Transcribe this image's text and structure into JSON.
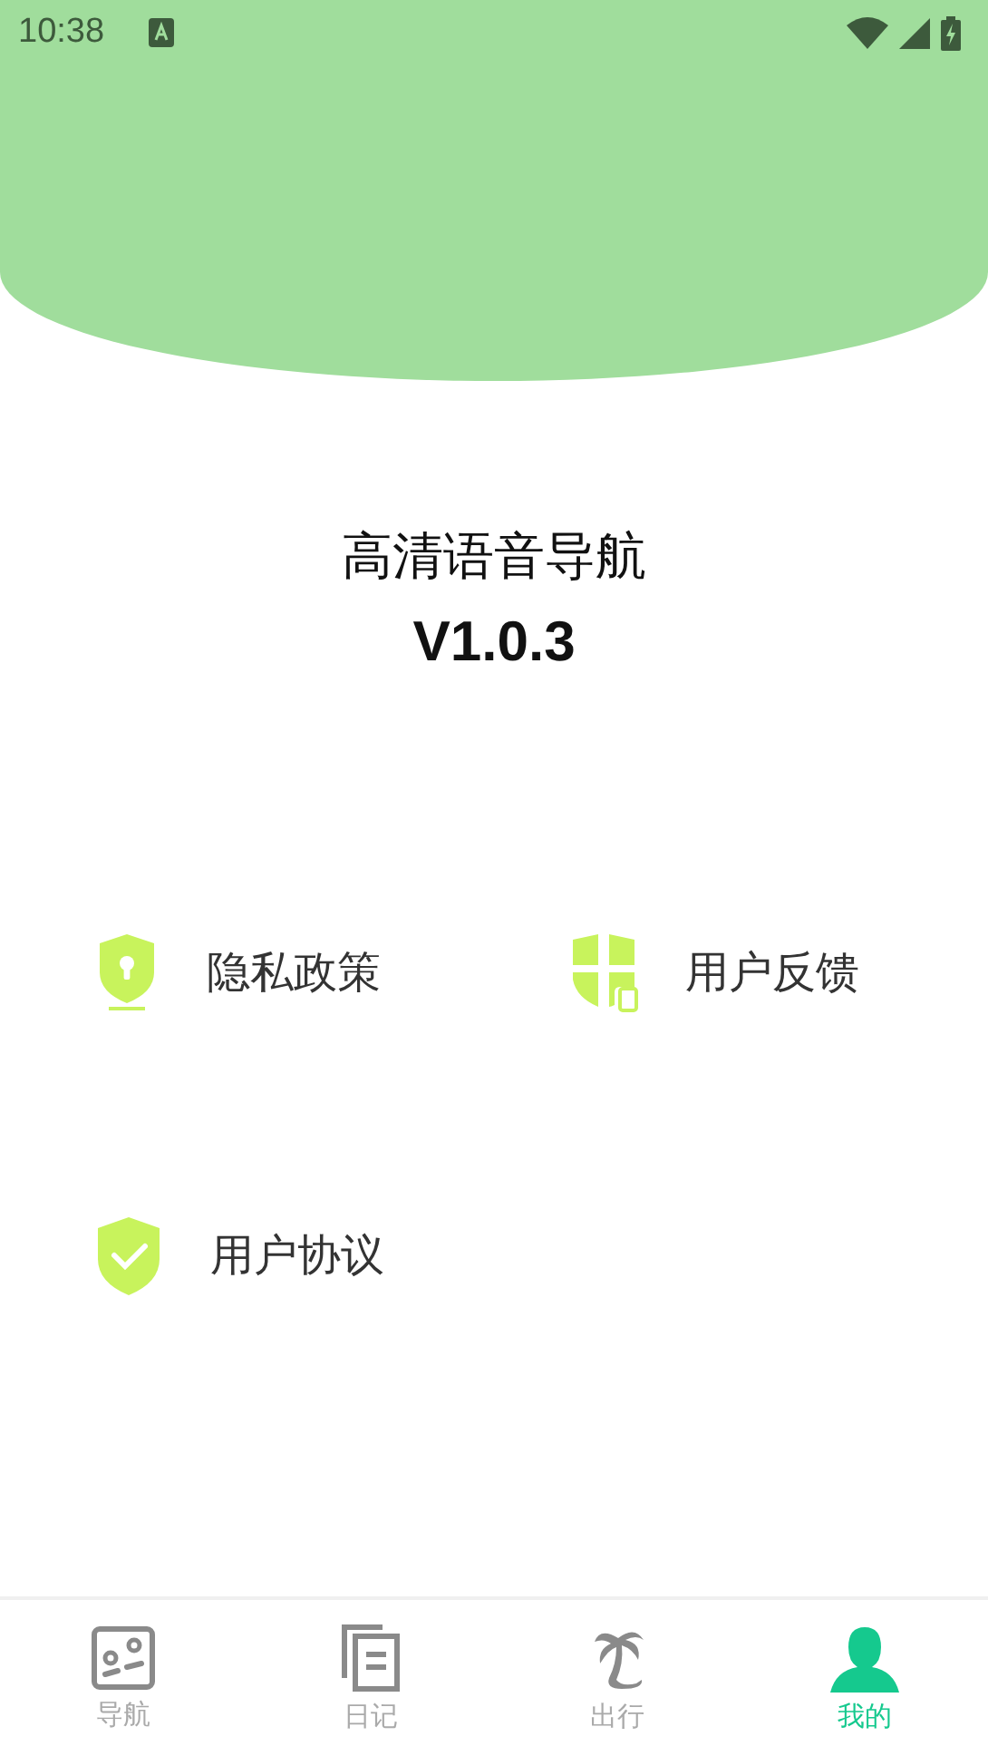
{
  "status_bar": {
    "time": "10:38"
  },
  "app": {
    "title": "高清语音导航",
    "version": "V1.0.3"
  },
  "menu_items": [
    {
      "label": "隐私政策",
      "kind": "privacy"
    },
    {
      "label": "用户反馈",
      "kind": "feedback"
    },
    {
      "label": "用户协议",
      "kind": "agreement"
    }
  ],
  "tabs": [
    {
      "label": "导航",
      "kind": "map",
      "selected": false
    },
    {
      "label": "日记",
      "kind": "diary",
      "selected": false
    },
    {
      "label": "出行",
      "kind": "travel",
      "selected": false
    },
    {
      "label": "我的",
      "kind": "profile",
      "selected": true
    }
  ]
}
